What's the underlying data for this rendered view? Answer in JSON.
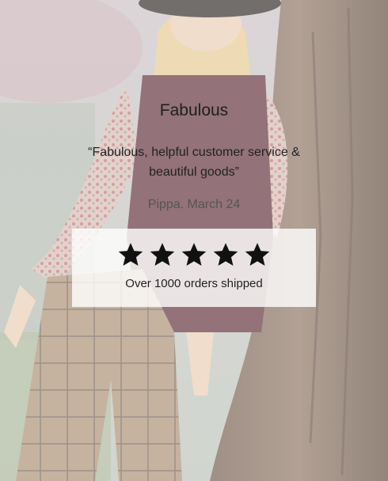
{
  "review": {
    "title": "Fabulous",
    "quote": "“Fabulous, helpful customer service & beautiful goods”",
    "author": "Pippa. March 24"
  },
  "rating": {
    "stars": 5,
    "star_icon": "star-icon",
    "summary": "Over 1000 orders shipped"
  },
  "colors": {
    "text": "#222222",
    "author_text": "#555555",
    "card_background": "#ffffff",
    "star": "#111111"
  }
}
